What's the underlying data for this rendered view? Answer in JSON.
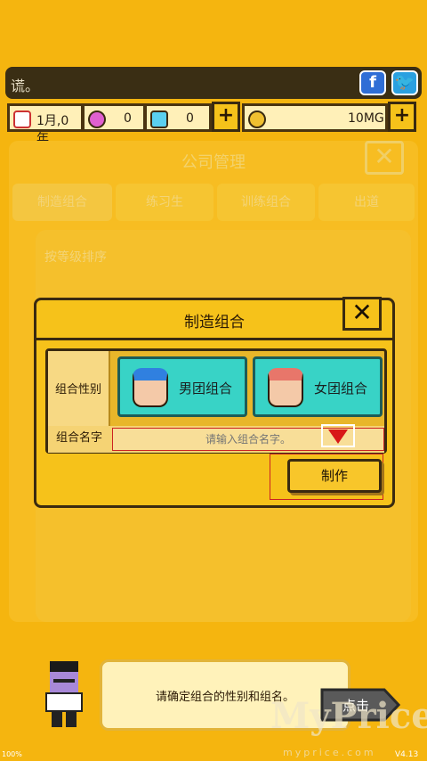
{
  "ticker": {
    "text": "谎。"
  },
  "resources": {
    "date": "1月,0年",
    "gems": "0",
    "diamonds": "0",
    "money": "10MG"
  },
  "bg_panel": {
    "title": "公司管理",
    "tabs": [
      "制造组合",
      "练习生",
      "训练组合",
      "出道"
    ],
    "subtitle": "按等级排序"
  },
  "dialog": {
    "title": "制造组合",
    "gender_label": "组合性别",
    "male_group": "男团组合",
    "female_group": "女团组合",
    "name_label": "组合名字",
    "name_placeholder": "请输入组合名字。",
    "make_button": "制作"
  },
  "tutorial": {
    "message": "请确定组合的性别和组名。",
    "click_label": "点击"
  },
  "watermark": {
    "main": "MyPrice",
    "sub": "myprice.com"
  },
  "footer": {
    "zoom": "100%",
    "version": "V4.13"
  },
  "colors": {
    "background": "#f5b50f",
    "accent_teal": "#38d3c6",
    "highlight_red": "#cc2222"
  }
}
